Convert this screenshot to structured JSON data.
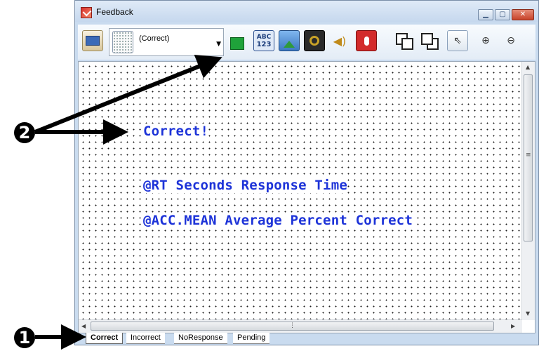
{
  "window": {
    "title": "Feedback"
  },
  "toolbar": {
    "display_name": "(Correct)",
    "abc_label": "ABC",
    "num_label": "123"
  },
  "canvas": {
    "lines": [
      "Correct!",
      "@RT Seconds Response Time",
      "@ACC.MEAN Average Percent Correct"
    ],
    "text_color": "#1d33d8"
  },
  "tabs": [
    "Correct",
    "Incorrect",
    "NoResponse",
    "Pending"
  ],
  "annotations": {
    "marker1": "1",
    "marker2": "2"
  }
}
